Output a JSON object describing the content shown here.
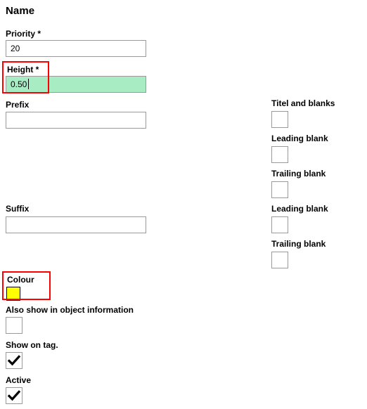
{
  "form": {
    "title": "Name",
    "required_marker": "*",
    "left_fields": [
      {
        "label": "Priority",
        "required": true,
        "label_text": "Priority *",
        "value": "20",
        "placeholder": "",
        "focused": false,
        "highlighted": false
      },
      {
        "label": "Height",
        "required": true,
        "label_text": "Height *",
        "value": "0.50",
        "placeholder": "",
        "focused": true,
        "highlighted": true
      },
      {
        "label": "Prefix",
        "required": false,
        "label_text": "Prefix",
        "value": "",
        "placeholder": "",
        "focused": false,
        "highlighted": false
      },
      {
        "label": "Suffix",
        "required": false,
        "label_text": "Suffix",
        "value": "",
        "placeholder": "",
        "focused": false,
        "highlighted": false
      }
    ],
    "colour": {
      "label": "Colour",
      "value": "#ffff00",
      "highlighted": true
    },
    "left_checkboxes": [
      {
        "label": "Also show in object information",
        "checked": false
      },
      {
        "label": "Show on tag.",
        "checked": true
      },
      {
        "label": "Active",
        "checked": true
      }
    ],
    "right_checkboxes": [
      {
        "label": "Titel and blanks",
        "checked": false
      },
      {
        "label": "Leading blank",
        "checked": false
      },
      {
        "label": "Trailing blank",
        "checked": false
      },
      {
        "label": "Leading blank",
        "checked": false
      },
      {
        "label": "Trailing blank",
        "checked": false
      }
    ]
  },
  "colors": {
    "focus_background": "#a8ecc4",
    "highlight_border": "#ff0000",
    "input_border": "#9a9a9a",
    "swatch_yellow": "#ffff00",
    "text": "#000000",
    "page_background": "#ffffff"
  }
}
